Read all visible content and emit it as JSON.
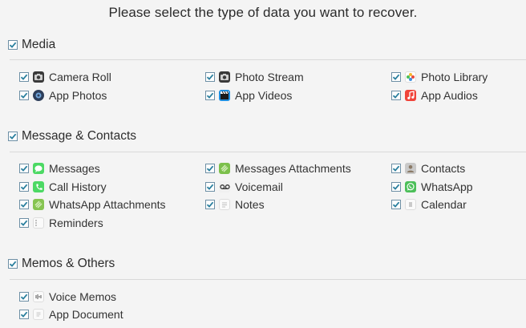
{
  "title": "Please select the type of data you want to recover.",
  "sections": {
    "media": {
      "label": "Media",
      "items": {
        "camera_roll": "Camera Roll",
        "photo_stream": "Photo Stream",
        "photo_library": "Photo Library",
        "app_photos": "App Photos",
        "app_videos": "App Videos",
        "app_audios": "App Audios"
      }
    },
    "messages": {
      "label": "Message & Contacts",
      "items": {
        "messages": "Messages",
        "messages_attachments": "Messages Attachments",
        "contacts": "Contacts",
        "call_history": "Call History",
        "voicemail": "Voicemail",
        "whatsapp": "WhatsApp",
        "whatsapp_attachments": "WhatsApp Attachments",
        "notes": "Notes",
        "calendar": "Calendar",
        "reminders": "Reminders"
      }
    },
    "memos": {
      "label": "Memos & Others",
      "items": {
        "voice_memos": "Voice Memos",
        "app_document": "App Document"
      }
    }
  },
  "colors": {
    "check": "#2a7f9e",
    "checkbox_border": "#6d8fa5",
    "divider": "#d9d9d9",
    "background": "#f4f4f4"
  }
}
